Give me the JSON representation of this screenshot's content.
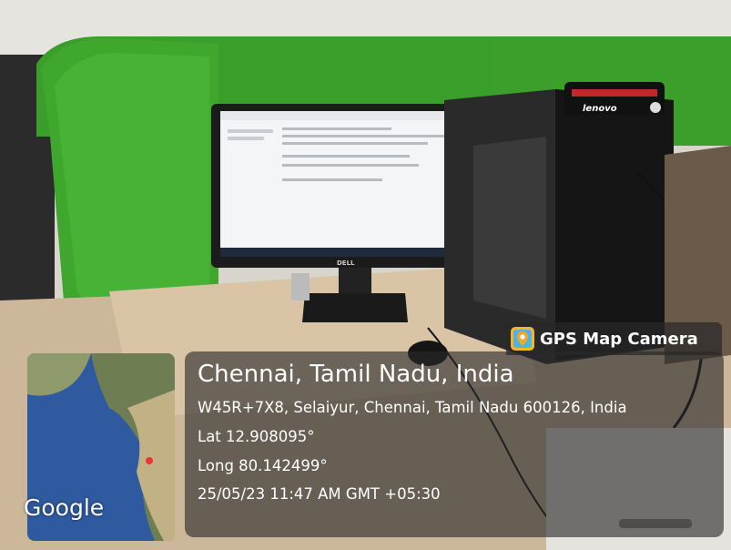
{
  "photo": {
    "monitor_brand": "DELL",
    "pc_brand": "lenovo"
  },
  "overlay": {
    "app_badge": "GPS Map Camera",
    "app_icon": "map-pin-icon",
    "city_line": "Chennai, Tamil Nadu, India",
    "address": "W45R+7X8, Selaiyur, Chennai, Tamil Nadu 600126, India",
    "latitude": "Lat 12.908095°",
    "longitude": "Long 80.142499°",
    "datetime": "25/05/23 11:47 AM GMT +05:30",
    "map_label": "Google"
  },
  "colors": {
    "partition_green": "#3a9e2a",
    "overlay_bg": "#282828"
  }
}
